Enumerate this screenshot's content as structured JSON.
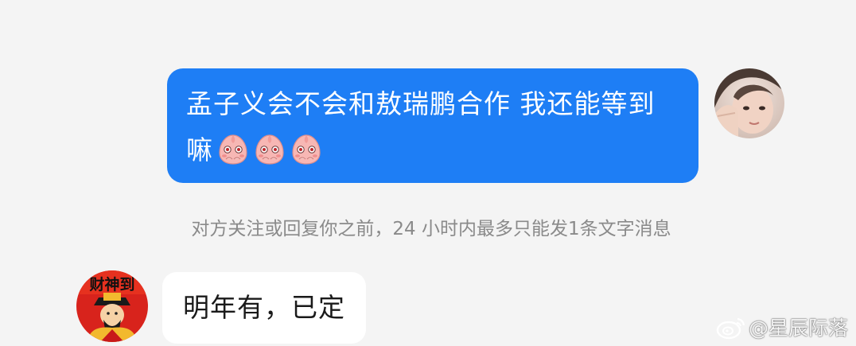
{
  "conversation": {
    "outgoing": {
      "text": "孟子义会不会和敖瑞鹏合作 我还能等到嘛",
      "emoji_count": 3,
      "emoji_icon": "shy-peach-emoji",
      "bubble_color": "#1e7ef5",
      "avatar_icon": "user-avatar-photo"
    },
    "notice": "对方关注或回复你之前，24 小时内最多只能发1条文字消息",
    "incoming": {
      "text": "明年有，已定",
      "avatar_icon": "caishen-avatar",
      "avatar_text": "财神到"
    }
  },
  "watermark": {
    "logo_icon": "weibo-logo-icon",
    "text": "@星辰际落"
  }
}
